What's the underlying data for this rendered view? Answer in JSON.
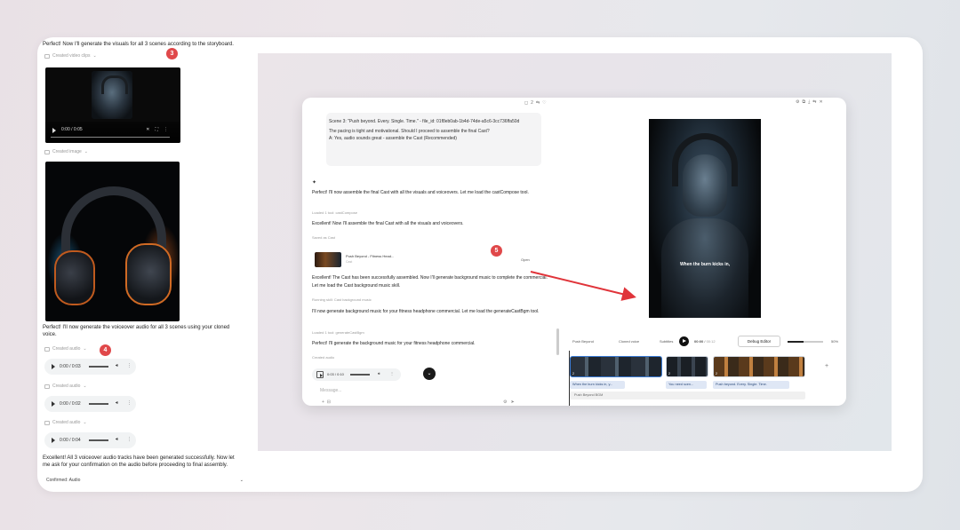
{
  "left": {
    "intro_text": "Perfect! Now I'll generate the visuals for all 3 scenes according to the storyboard.",
    "created_video_label": "Created video clips",
    "badge_3": "3",
    "video_time": "0:00 / 0:05",
    "created_image_label": "Created image",
    "voiceover_text": "Perfect! I'll now generate the voiceover audio for all 3 scenes using your cloned voice.",
    "badge_4": "4",
    "audio_label": "Created audio",
    "audio_clips": [
      {
        "time": "0:00 / 0:03"
      },
      {
        "time": "0:00 / 0:02"
      },
      {
        "time": "0:00 / 0:04"
      }
    ],
    "done_text": "Excellent! All 3 voiceover audio tracks have been generated successfully. Now let me ask for your confirmation on the audio before proceeding to final assembly.",
    "confirmed_label": "Confirmed: Audio"
  },
  "chat": {
    "scene_line": "Scene 3: \"Push beyond. Every. Single. Time.\" - file_id: 01f8eb0ab-1b4d-74de-a5c6-3cc736ffa50d",
    "pacing_line": "The pacing is tight and motivational. Should I proceed to assemble the final Cast?",
    "answer_line": "A: Yes, audio sounds great - assemble the Cast (Recommended)",
    "msg1": "Perfect! I'll now assemble the final Cast with all the visuals and voiceovers. Let me load the castCompose tool.",
    "meta1": "Loaded 1 tool: castCompose",
    "msg2": "Excellent! Now I'll assemble the final Cast with all the visuals and voiceovers.",
    "meta2": "Saved as Cast",
    "cast_title": "Push Beyond - Fitness Head...",
    "cast_sub": "Cast",
    "cast_open": "Open",
    "badge_5": "5",
    "msg3": "Excellent! The Cast has been successfully assembled. Now I'll generate background music to complete the commercial. Let me load the Cast background music skill.",
    "meta3": "Running skill: Cast background music",
    "msg4": "I'll now generate background music for your fitness headphone commercial. Let me load the generateCastBgm tool.",
    "meta4": "Loaded 1 tool: generateCastBgm",
    "msg5": "Perfect! I'll generate the background music for your fitness headphone commercial.",
    "meta5": "Created audio",
    "mini_audio_time": "0:03 / 0:10",
    "input_placeholder": "Message...",
    "top_count": "2"
  },
  "preview": {
    "caption": "When the burn kicks in,",
    "toolbar": {
      "push_label": "Push Beyond",
      "cloned_label": "Cloned voice",
      "subs_label": "Subtitles",
      "time_current": "00:00",
      "time_total": "00:12",
      "debug_label": "Debug Editor",
      "zoom_pct": "50%"
    },
    "clips": [
      {
        "label": "2"
      },
      {
        "label": "2"
      },
      {
        "label": "2"
      }
    ],
    "subtitles": [
      "When the burn kicks in, y...",
      "You need scen...",
      "Push beyond. Every. Single. Time."
    ],
    "music_track": "Push Beyond BGM"
  },
  "colors": {
    "badge": "#e0484a",
    "arrow": "#e0343a",
    "clip_border": "#3a7bd5"
  }
}
